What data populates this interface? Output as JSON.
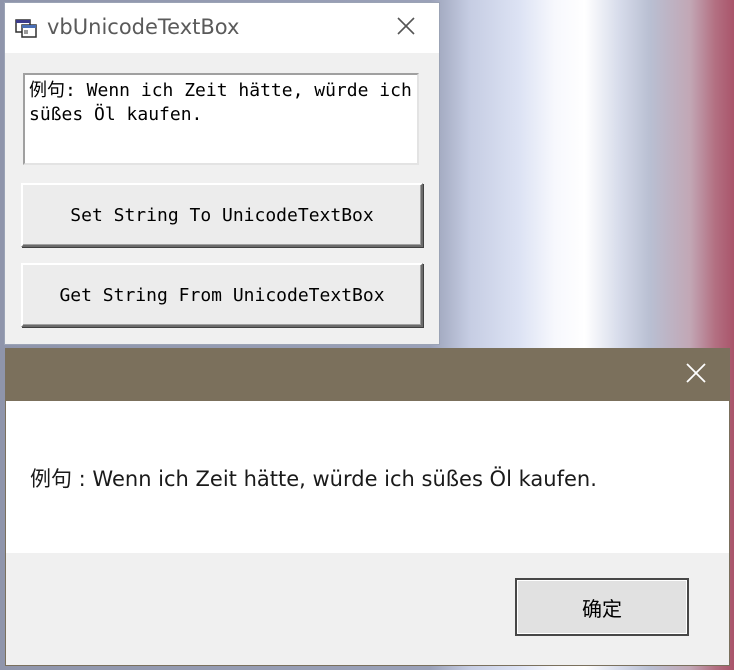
{
  "main_window": {
    "title": "vbUnicodeTextBox",
    "app_icon": "vb-form-icon",
    "close_icon": "close-icon",
    "textbox": {
      "value": "例句: Wenn ich Zeit hätte, würde ich süßes Öl kaufen."
    },
    "buttons": {
      "set_label": "Set String To UnicodeTextBox",
      "get_label": "Get String From UnicodeTextBox"
    }
  },
  "message_box": {
    "close_icon": "close-icon",
    "message": "例句 : Wenn ich Zeit hätte, würde ich süßes Öl kaufen.",
    "ok_label": "确定"
  },
  "colors": {
    "dialog_titlebar": "#7b705c",
    "window_face": "#f0f0f0"
  }
}
